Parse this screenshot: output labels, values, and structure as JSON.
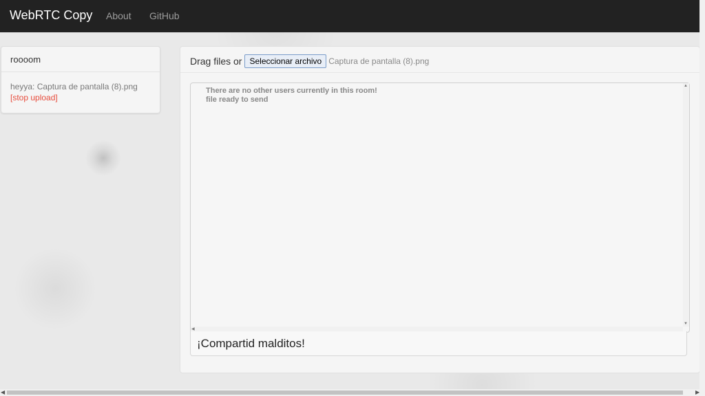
{
  "navbar": {
    "brand": "WebRTC Copy",
    "links": [
      "About",
      "GitHub"
    ]
  },
  "room": {
    "name": "roooom",
    "file_entry": {
      "text": "heyya: Captura de pantalla (8).png",
      "stop_label": "[stop upload]"
    }
  },
  "upload": {
    "drag_label": "Drag files or",
    "button_label": "Seleccionar archivo",
    "selected_file": "Captura de pantalla (8).png"
  },
  "log": {
    "lines": [
      "There are no other users currently in this room!",
      "file ready to send"
    ]
  },
  "message": {
    "value": "¡Compartid malditos!"
  },
  "colors": {
    "navbar_bg": "#222222",
    "brand_text": "#ffffff",
    "nav_link": "#9d9d9d",
    "stop_link": "#e74c3c"
  }
}
